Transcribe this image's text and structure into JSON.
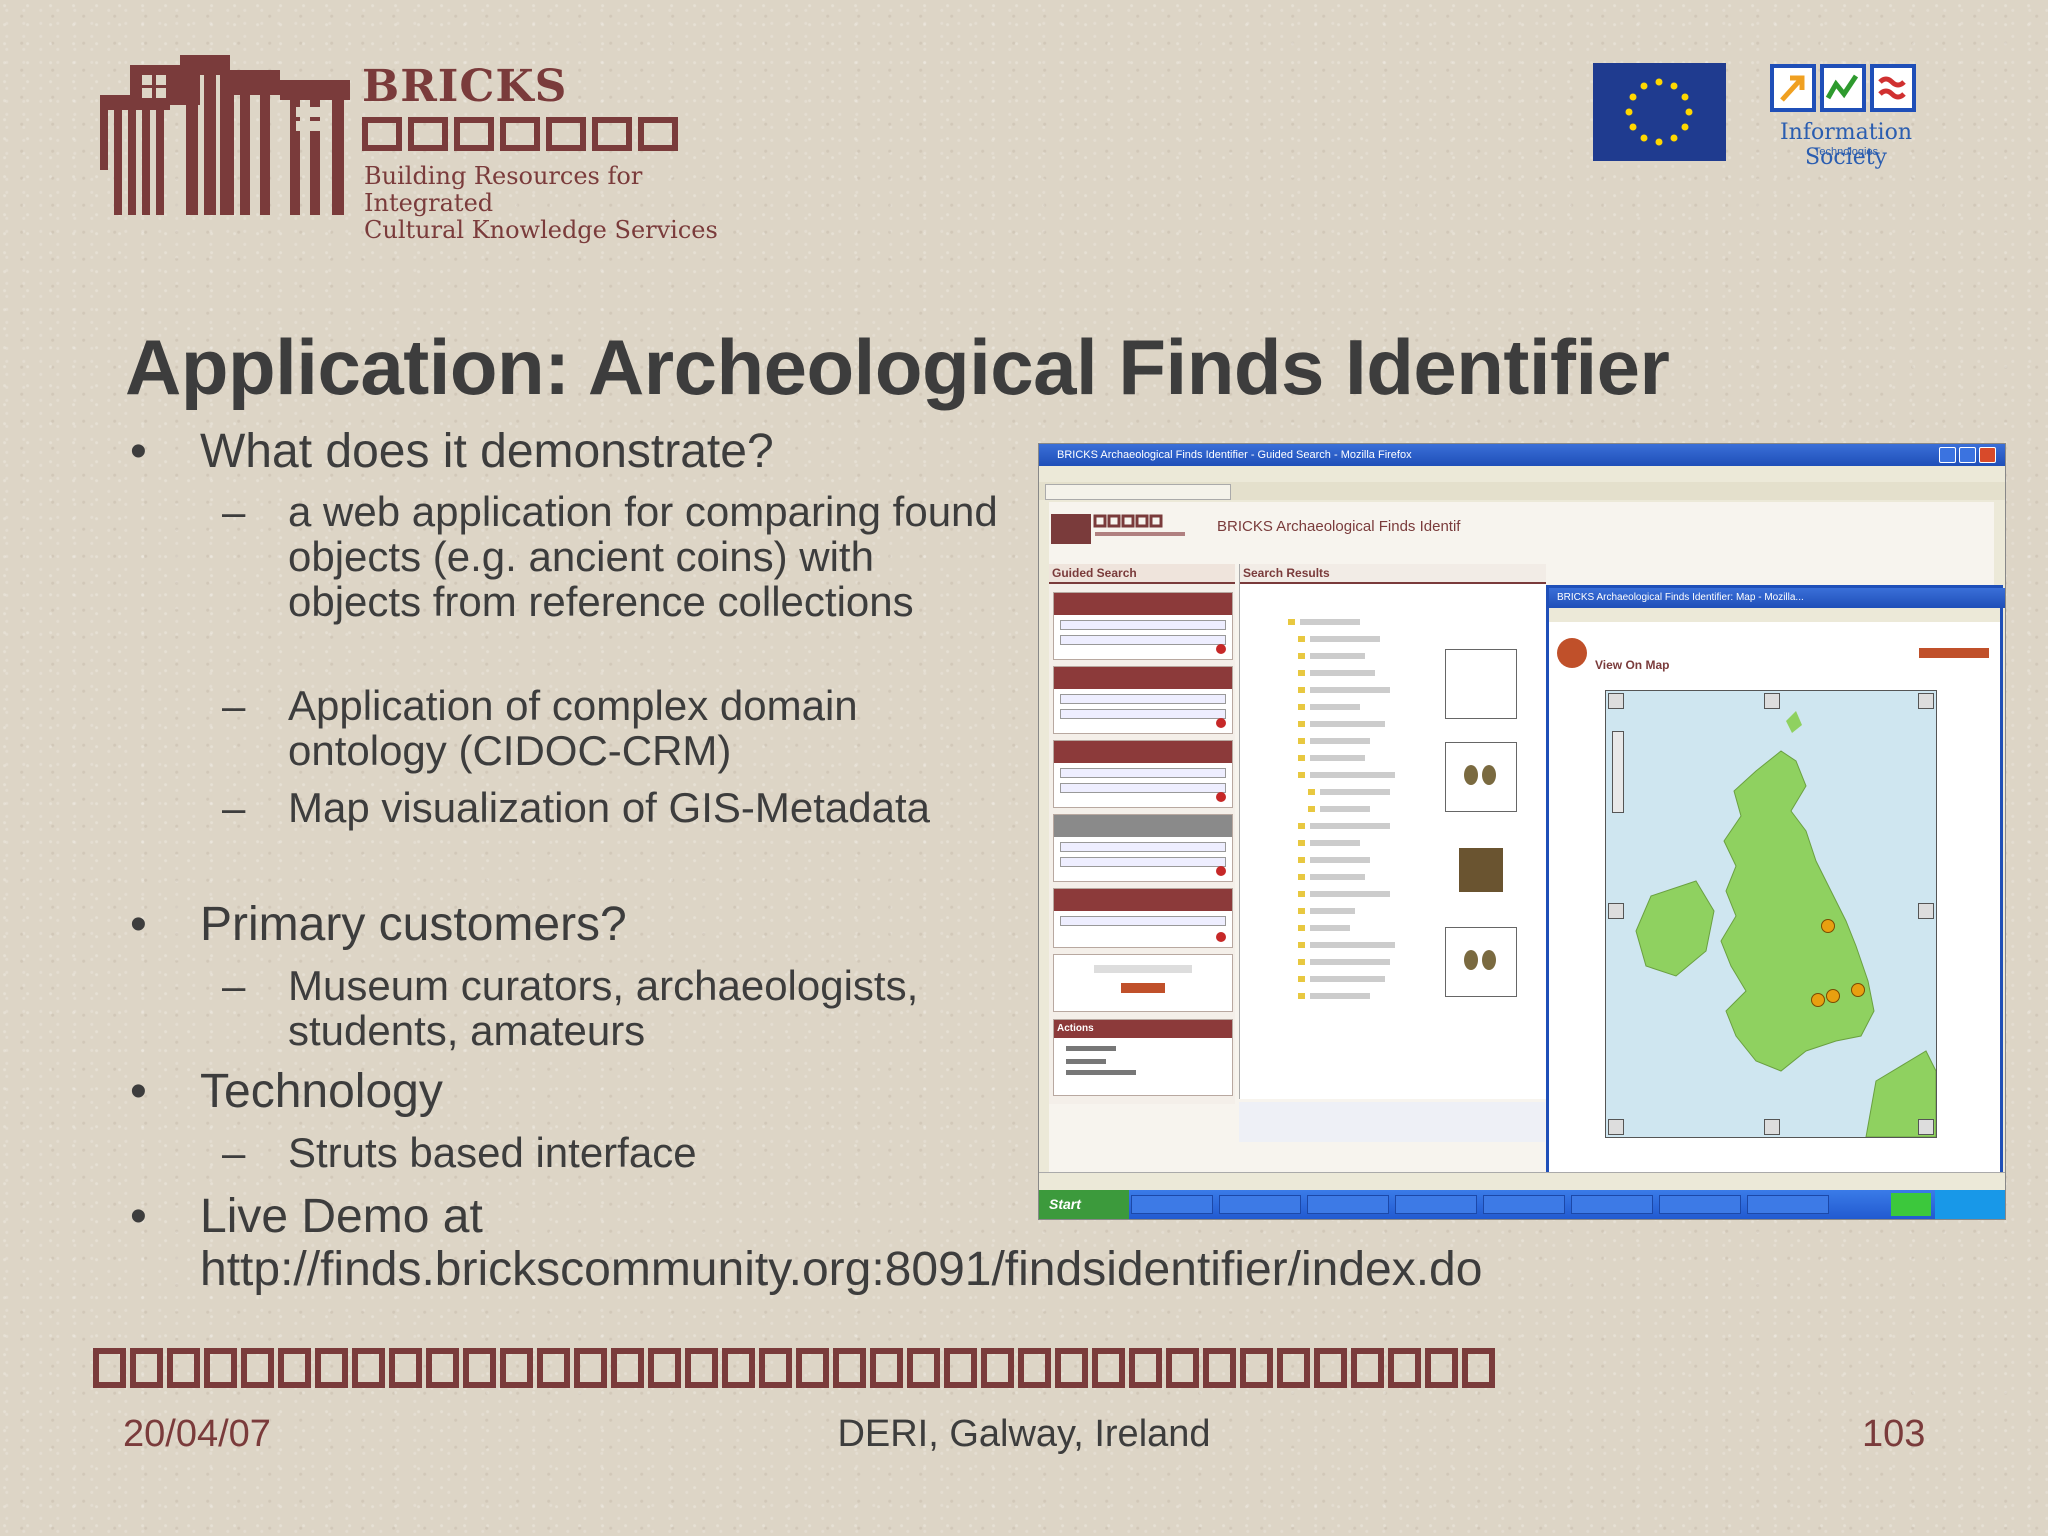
{
  "logo": {
    "name": "BRICKS",
    "tagline": "Building Resources for Integrated\nCultural Knowledge Services"
  },
  "sponsor_logo": {
    "text": "Information Society",
    "subtext": "Technologies"
  },
  "slide": {
    "title": "Application: Archeological Finds Identifier",
    "bullets": [
      {
        "text": "What does it demonstrate?",
        "sub": [
          "a web application for comparing found objects (e.g. ancient coins) with objects from reference collections",
          "Application of complex domain ontology (CIDOC-CRM)",
          "Map visualization of GIS-Metadata"
        ]
      },
      {
        "text": "Primary customers?",
        "sub": [
          "Museum curators, archaeologists, students, amateurs"
        ]
      },
      {
        "text": "Technology",
        "sub": [
          "Struts based interface"
        ]
      },
      {
        "text": "Live Demo at",
        "url": "http://finds.brickscommunity.org:8091/findsidentifier/index.do"
      }
    ]
  },
  "screenshot": {
    "browser_title": "BRICKS Archaeological Finds Identifier - Guided Search - Mozilla Firefox",
    "app_title": "BRICKS Archaeological Finds Identif",
    "guided_search": "Guided Search",
    "search_results": "Search Results",
    "actions": "Actions",
    "map_window_title": "BRICKS Archaeological Finds Identifier: Map - Mozilla...",
    "map_heading": "View On Map",
    "start": "Start"
  },
  "footer": {
    "date": "20/04/07",
    "location": "DERI, Galway, Ireland",
    "page": "103"
  },
  "colors": {
    "brand": "#7a3b3b",
    "text": "#3d3d3d",
    "background": "#ddd5c6"
  }
}
